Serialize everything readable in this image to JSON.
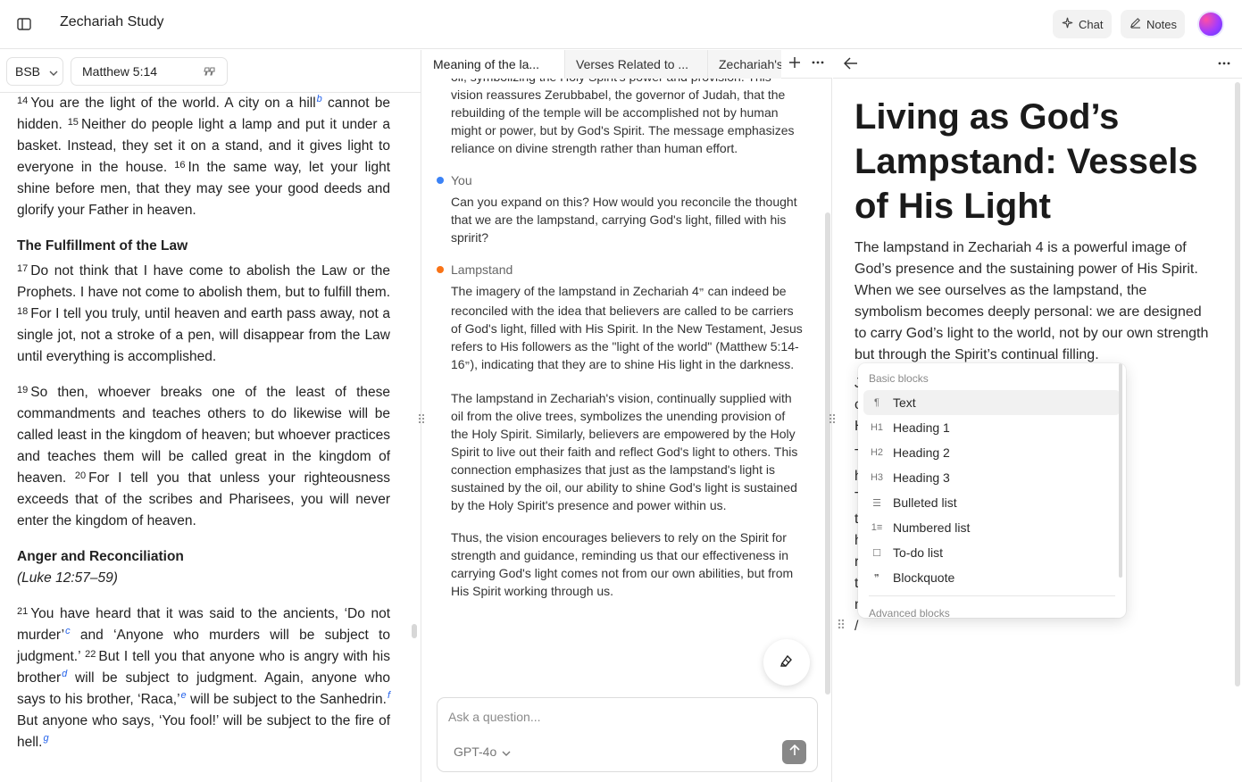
{
  "app": {
    "title": "Zechariah Study"
  },
  "header": {
    "chat_label": "Chat",
    "notes_label": "Notes"
  },
  "bible": {
    "version": "BSB",
    "reference": "Matthew 5:14",
    "p1": [
      {
        "v": "14",
        "t": "You are the light of the world. A city on a hill"
      },
      {
        "fn": "b"
      },
      {
        "t": " cannot be hidden. "
      },
      {
        "v": "15",
        "t": "Neither do people light a lamp and put it under a basket. Instead, they set it on a stand, and it gives light to everyone in the house. "
      },
      {
        "v": "16",
        "t": "In the same way, let your light shine before men, that they may see your good deeds and glorify your Father in heaven."
      }
    ],
    "heading1": "The Fulfillment of the Law",
    "p2": [
      {
        "v": "17",
        "t": "Do not think that I have come to abolish the Law or the Prophets. I have not come to abolish them, but to fulfill them. "
      },
      {
        "v": "18",
        "t": "For I tell you truly, until heaven and earth pass away, not a single jot, not a stroke of a pen, will disappear from the Law until everything is accomplished."
      }
    ],
    "p3": [
      {
        "v": "19",
        "t": "So then, whoever breaks one of the least of these commandments and teaches others to do likewise will be called least in the kingdom of heaven; but whoever practices and teaches them will be called great in the kingdom of heaven. "
      },
      {
        "v": "20",
        "t": "For I tell you that unless your righteousness exceeds that of the scribes and Pharisees, you will never enter the kingdom of heaven."
      }
    ],
    "heading2": "Anger and Reconciliation",
    "xref": "(Luke 12:57–59)",
    "p4": [
      {
        "v": "21",
        "t": "You have heard that it was said to the ancients, ‘Do not murder’"
      },
      {
        "fn": "c"
      },
      {
        "t": " and ‘Anyone who murders will be subject to judgment.’ "
      },
      {
        "v": "22",
        "t": "But I tell you that anyone who is angry with his brother"
      },
      {
        "fn": "d"
      },
      {
        "t": " will be subject to judgment. Again, anyone who says to his brother, ‘Raca,’"
      },
      {
        "fn": "e"
      },
      {
        "t": " will be subject to the Sanhedrin."
      },
      {
        "fn": "f"
      },
      {
        "t": " But anyone who says, ‘You fool!’ will be subject to the fire of hell."
      },
      {
        "fn": "g"
      }
    ]
  },
  "chat": {
    "tabs": [
      "Meaning of the la...",
      "Verses Related to ...",
      "Zechariah's"
    ],
    "intro": "oil, symbolizing the Holy Spirit's power and provision. This vision reassures Zerubbabel, the governor of Judah, that the rebuilding of the temple will be accomplished not by human might or power, but by God's Spirit. The message emphasizes reliance on divine strength rather than human effort.",
    "user": {
      "name": "You",
      "color": "#3b82f6",
      "message": "Can you expand on this? How would you reconcile the thought that we are the lampstand, carrying God's light, filled with his spririt?"
    },
    "assistant": {
      "name": "Lampstand",
      "color": "#f97316",
      "p1_a": "The imagery of the lampstand in Zechariah 4",
      "p1_b": " can indeed be reconciled with the idea that believers are called to be carriers of God's light, filled with His Spirit. In the New Testament, Jesus refers to His followers as the \"light of the world\" (Matthew 5:14-16",
      "p1_c": "), indicating that they are to shine His light in the darkness.",
      "p2": "The lampstand in Zechariah's vision, continually supplied with oil from the olive trees, symbolizes the unending provision of the Holy Spirit. Similarly, believers are empowered by the Holy Spirit to live out their faith and reflect God's light to others. This connection emphasizes that just as the lampstand's light is sustained by the oil, our ability to shine God's light is sustained by the Holy Spirit's presence and power within us.",
      "p3": "Thus, the vision encourages believers to rely on the Spirit for strength and guidance, reminding us that our effectiveness in carrying God's light comes not from our own abilities, but from His Spirit working through us."
    },
    "composer": {
      "placeholder": "Ask a question...",
      "model": "GPT-4o"
    }
  },
  "note": {
    "title": "Living as God’s Lampstand: Vessels of His Light",
    "p1": "The lampstand in Zechariah 4 is a powerful image of God’s presence and the sustaining power of His Spirit. When we see ourselves as the lampstand, the symbolism becomes deeply personal: we are designed to carry God’s light to the world, not by our own strength but through the Spirit’s continual filling.",
    "p2_lines": [
      "J                                              lled by a",
      "c                                             ueled by the",
      "H"
    ],
    "p3_lines": [
      "T                                              s. It reveals",
      "h                                              oken world.",
      "T                                              eminding us",
      "t                                               perfect and",
      "h                                               temple to",
      "r                                               His living",
      "t                                               o—not by",
      "m                                              lory."
    ],
    "slash": "/"
  },
  "block_menu": {
    "section_basic": "Basic blocks",
    "items": [
      {
        "icon": "¶",
        "label": "Text"
      },
      {
        "icon": "H1",
        "label": "Heading 1"
      },
      {
        "icon": "H2",
        "label": "Heading 2"
      },
      {
        "icon": "H3",
        "label": "Heading 3"
      },
      {
        "icon": "☰",
        "label": "Bulleted list"
      },
      {
        "icon": "1≡",
        "label": "Numbered list"
      },
      {
        "icon": "☐",
        "label": "To-do list"
      },
      {
        "icon": "❞",
        "label": "Blockquote"
      }
    ],
    "section_advanced": "Advanced blocks"
  }
}
